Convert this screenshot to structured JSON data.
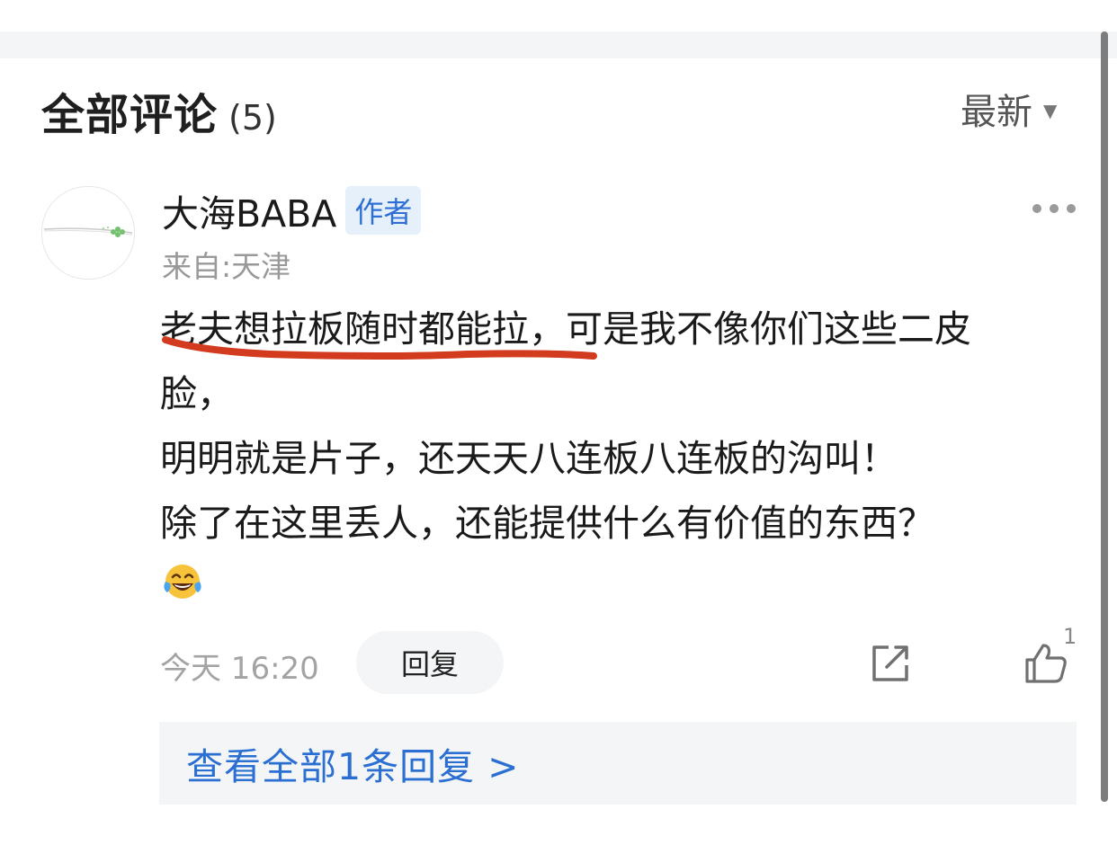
{
  "section": {
    "title": "全部评论",
    "count": "(5)"
  },
  "sort": {
    "label": "最新",
    "icon": "caret-down-icon"
  },
  "comment": {
    "author": "大海BABA",
    "author_badge": "作者",
    "location": "来自:天津",
    "lines": {
      "l1_underlined": "老夫想拉板随时都能拉，",
      "l1_rest": "可是我不像你们这些二皮",
      "l2": "脸，",
      "l3": "明明就是片子，还天天八连板八连板的沟叫！",
      "l4": "除了在这里丢人，还能提供什么有价值的东西？"
    },
    "emoji": "laughing-tears-emoji",
    "time": "今天 16:20",
    "reply_label": "回复",
    "like_count": "1",
    "view_replies": "查看全部1条回复 >"
  },
  "colors": {
    "accent_blue": "#2a6fd1",
    "underline_red": "#d23b1e",
    "muted_gray": "#999999"
  }
}
